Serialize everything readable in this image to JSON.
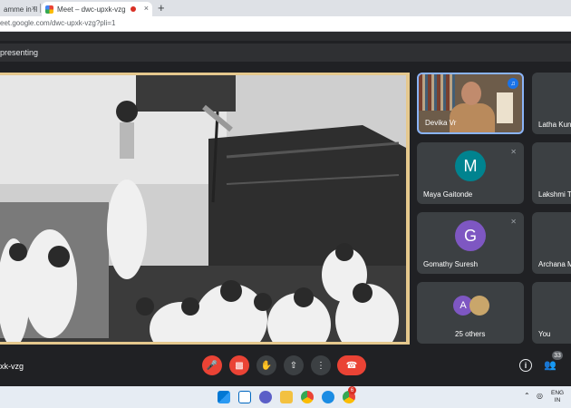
{
  "browser": {
    "tab1_title": "amme in II",
    "tab2_title": "Meet – dwc-upxk-vzg",
    "url_domain": "meet.google.com",
    "url_path": "/dwc-upxk-vzg?pli=1",
    "url_display": "eet.google.com/dwc-upxk-vzg?pli=1"
  },
  "meeting": {
    "presenting_label": "presenting",
    "code_label": "xk-vzg",
    "participant_count": "33"
  },
  "tiles": [
    {
      "name": "Devika Vr"
    },
    {
      "name": "Latha Kun"
    },
    {
      "name": "Maya Gaitonde",
      "initial": "M",
      "color": "#00838f"
    },
    {
      "name": "Lakshmi T"
    },
    {
      "name": "Gomathy Suresh",
      "initial": "G",
      "color": "#7e57c2"
    },
    {
      "name": "Archana M"
    },
    {
      "name": "25 others",
      "initial": "A",
      "color": "#7e57c2"
    },
    {
      "name": "You"
    }
  ],
  "taskbar": {
    "lang_top": "ENG",
    "lang_bottom": "IN",
    "notification_badge": "6"
  },
  "colors": {
    "accent": "#1a73e8",
    "danger": "#ea4335",
    "frame": "#e5c88d"
  }
}
